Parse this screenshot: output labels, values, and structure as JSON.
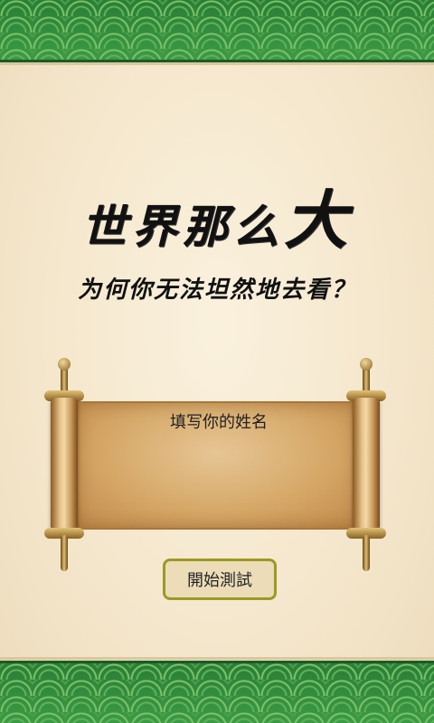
{
  "header": {
    "title_main": "世界那么",
    "title_big": "大",
    "subtitle": "为何你无法坦然地去看？"
  },
  "form": {
    "name_placeholder": "填写你的姓名",
    "name_value": ""
  },
  "actions": {
    "start_label": "開始測試"
  },
  "colors": {
    "band_green": "#2f8a3a",
    "paper": "#f6ead2",
    "scroll": "#d6a868",
    "button_border": "#9a9a24"
  },
  "icons": {
    "scroll": "scroll-icon"
  }
}
